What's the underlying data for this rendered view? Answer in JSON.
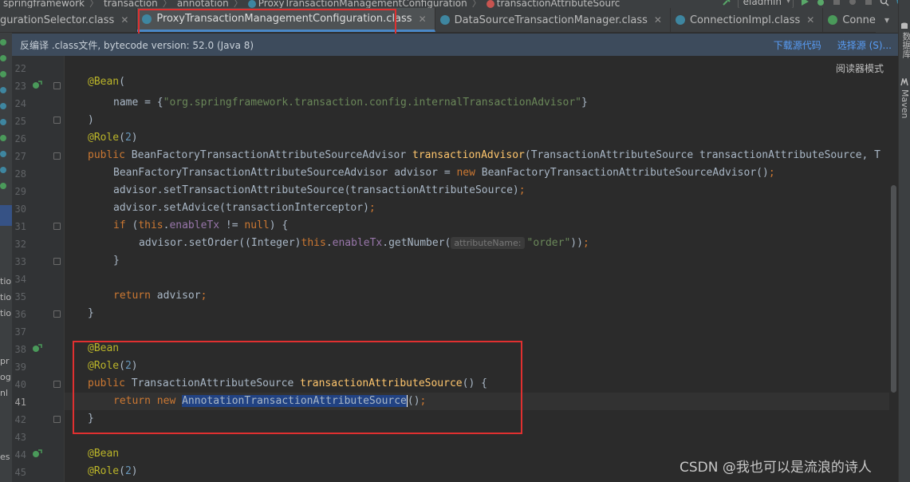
{
  "breadcrumb": {
    "items": [
      "springframework",
      "transaction",
      "annotation",
      "ProxyTransactionManagementConfiguration",
      "transactionAttributeSourc"
    ]
  },
  "toolbar": {
    "run_config": "eladmin"
  },
  "tabs": [
    {
      "label": "gurationSelector.class",
      "active": false
    },
    {
      "label": "ProxyTransactionManagementConfiguration.class",
      "active": true
    },
    {
      "label": "DataSourceTransactionManager.class",
      "active": false
    },
    {
      "label": "ConnectionImpl.class",
      "active": false
    },
    {
      "label": "ConnectionLifecycleInte",
      "active": false
    }
  ],
  "banner": {
    "text": "反编译 .class文件, bytecode version: 52.0 (Java 8)",
    "download_sources": "下载源代码",
    "choose_sources": "选择源 (S)..."
  },
  "reader_mode": "阅读器模式",
  "right_tools": {
    "db": "数据库",
    "maven": "Maven"
  },
  "left_strip": {
    "texts": [
      "tio",
      "tio",
      "tio",
      "pr",
      "og",
      "nl",
      "es"
    ]
  },
  "line_numbers": [
    "22",
    "23",
    "24",
    "25",
    "26",
    "27",
    "28",
    "29",
    "30",
    "31",
    "32",
    "33",
    "34",
    "35",
    "36",
    "37",
    "38",
    "39",
    "40",
    "41",
    "42",
    "43",
    "44",
    "45"
  ],
  "code": {
    "l23_ann": "@Bean",
    "l23_paren": "(",
    "l24_name": "name = {",
    "l24_str": "\"org.springframework.transaction.config.internalTransactionAdvisor\"",
    "l24_close": "}",
    "l25": ")",
    "l26_ann": "@Role",
    "l26_open": "(",
    "l26_num": "2",
    "l26_close": ")",
    "l27_kw": "public",
    "l27_type": " BeanFactoryTransactionAttributeSourceAdvisor ",
    "l27_fn": "transactionAdvisor",
    "l27_rest": "(TransactionAttributeSource transactionAttributeSource, T",
    "l28_a": "BeanFactoryTransactionAttributeSourceAdvisor advisor = ",
    "l28_kw": "new",
    "l28_b": " BeanFactoryTransactionAttributeSourceAdvisor()",
    "l28_semi": ";",
    "l29": "advisor.setTransactionAttributeSource(transactionAttributeSource)",
    "l29_semi": ";",
    "l30": "advisor.setAdvice(transactionInterceptor)",
    "l30_semi": ";",
    "l31_kw": "if",
    "l31_a": " (",
    "l31_this": "this",
    "l31_dot": ".",
    "l31_fld": "enableTx",
    "l31_b": " != ",
    "l31_null": "null",
    "l31_c": ") {",
    "l32_a": "advisor.setOrder((Integer)",
    "l32_this": "this",
    "l32_dot": ".",
    "l32_fld": "enableTx",
    "l32_b": ".getNumber(",
    "l32_hint": "attributeName:",
    "l32_str": "\"order\"",
    "l32_c": "))",
    "l32_semi": ";",
    "l33": "}",
    "l35_kw": "return",
    "l35_a": " advisor",
    "l35_semi": ";",
    "l36": "}",
    "l38_ann": "@Bean",
    "l39_ann": "@Role",
    "l39_open": "(",
    "l39_num": "2",
    "l39_close": ")",
    "l40_kw": "public",
    "l40_type": " TransactionAttributeSource ",
    "l40_fn": "transactionAttributeSource",
    "l40_rest": "() {",
    "l41_kw": "return",
    "l41_sp": " ",
    "l41_new": "new",
    "l41_sp2": " ",
    "l41_sel": "AnnotationTransactionAttributeSource",
    "l41_rest": "()",
    "l41_semi": ";",
    "l42": "}",
    "l44_ann": "@Bean",
    "l45_ann": "@Role",
    "l45_open": "(",
    "l45_num": "2",
    "l45_close": ")"
  },
  "watermark": "CSDN @我也可以是流浪的诗人",
  "colors": {
    "annotation": "#bbb529",
    "keyword": "#cc7832",
    "string": "#6a8759",
    "field": "#9876aa",
    "number": "#6897bb",
    "method": "#ffc66d",
    "highlight_box": "#e03030",
    "active_tab_underline": "#4a88c7"
  }
}
